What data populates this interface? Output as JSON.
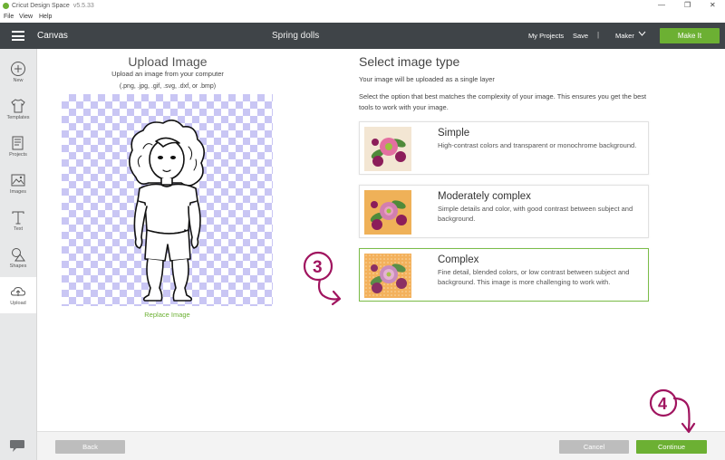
{
  "window": {
    "app_title": "Cricut Design Space",
    "version": "v5.5.33",
    "controls": {
      "minimize": "—",
      "restore": "❐",
      "close": "✕"
    }
  },
  "menu": {
    "items": [
      "File",
      "View",
      "Help"
    ]
  },
  "header": {
    "section": "Canvas",
    "project_name": "Spring dolls",
    "my_projects": "My Projects",
    "save": "Save",
    "separator": "|",
    "machine": "Maker",
    "make_it": "Make It"
  },
  "sidebar": {
    "items": [
      {
        "label": "New",
        "icon": "plus-circle-icon"
      },
      {
        "label": "Templates",
        "icon": "shirt-icon"
      },
      {
        "label": "Projects",
        "icon": "projects-icon"
      },
      {
        "label": "Images",
        "icon": "image-icon"
      },
      {
        "label": "Text",
        "icon": "text-icon"
      },
      {
        "label": "Shapes",
        "icon": "shapes-icon"
      },
      {
        "label": "Upload",
        "icon": "upload-cloud-icon"
      }
    ],
    "active": "Upload"
  },
  "upload": {
    "title": "Upload Image",
    "subtitle": "Upload an image from your computer",
    "formats": "(.png, .jpg, .gif, .svg, .dxf, or .bmp)",
    "replace_link": "Replace Image"
  },
  "select_type": {
    "title": "Select image type",
    "subtitle": "Your image will be uploaded as a single layer",
    "description": "Select the option that best matches the complexity of your image. This ensures you get the best tools to work with your image.",
    "options": [
      {
        "name": "Simple",
        "description": "High-contrast colors and transparent or monochrome background.",
        "thumb_bg": "#f3e6d3",
        "selected": false
      },
      {
        "name": "Moderately complex",
        "description": "Simple details and color, with good contrast between subject and background.",
        "thumb_bg": "#efb158",
        "selected": false
      },
      {
        "name": "Complex",
        "description": "Fine detail, blended colors, or low contrast between subject and background. This image is more challenging to work with.",
        "thumb_bg": "#f3b15c",
        "selected": true
      }
    ]
  },
  "footer": {
    "back": "Back",
    "cancel": "Cancel",
    "continue": "Continue"
  },
  "annotations": {
    "step_a": "3",
    "step_b": "4"
  },
  "colors": {
    "accent_green": "#6cb033",
    "header_dark": "#3f4448",
    "annotation_magenta": "#a0145f",
    "checker": "#c9c6f4"
  }
}
